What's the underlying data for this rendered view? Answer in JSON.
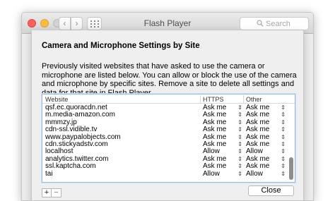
{
  "window": {
    "title": "Flash Player",
    "search_placeholder": "Search",
    "back_glyph": "‹",
    "forward_glyph": "›"
  },
  "dialog": {
    "heading": "Camera and Microphone Settings by Site",
    "description": "Previously visited websites that have asked to use the camera or microphone are listed below. You can allow or block the use of the camera and microphone by specific sites. Remove a site to delete all settings and data for that site in Flash Player.",
    "columns": [
      "Website",
      "HTTPS",
      "Other"
    ],
    "rows": [
      {
        "site": "qsf.ec.quoracdn.net",
        "https": "Ask me",
        "other": "Ask me"
      },
      {
        "site": "m.media-amazon.com",
        "https": "Ask me",
        "other": "Ask me"
      },
      {
        "site": "mmmzy.jp",
        "https": "Ask me",
        "other": "Ask me"
      },
      {
        "site": "cdn-ssl.vidible.tv",
        "https": "Ask me",
        "other": "Ask me"
      },
      {
        "site": "www.paypalobjects.com",
        "https": "Ask me",
        "other": "Ask me"
      },
      {
        "site": "cdn.stickyadstv.com",
        "https": "Ask me",
        "other": "Ask me"
      },
      {
        "site": "localhost",
        "https": "Allow",
        "other": "Allow"
      },
      {
        "site": "analytics.twitter.com",
        "https": "Ask me",
        "other": "Ask me"
      },
      {
        "site": "ssl.kaptcha.com",
        "https": "Ask me",
        "other": "Ask me"
      },
      {
        "site": "tai",
        "https": "Allow",
        "other": "Allow"
      }
    ],
    "add_label": "+",
    "remove_label": "−",
    "close_label": "Close"
  }
}
